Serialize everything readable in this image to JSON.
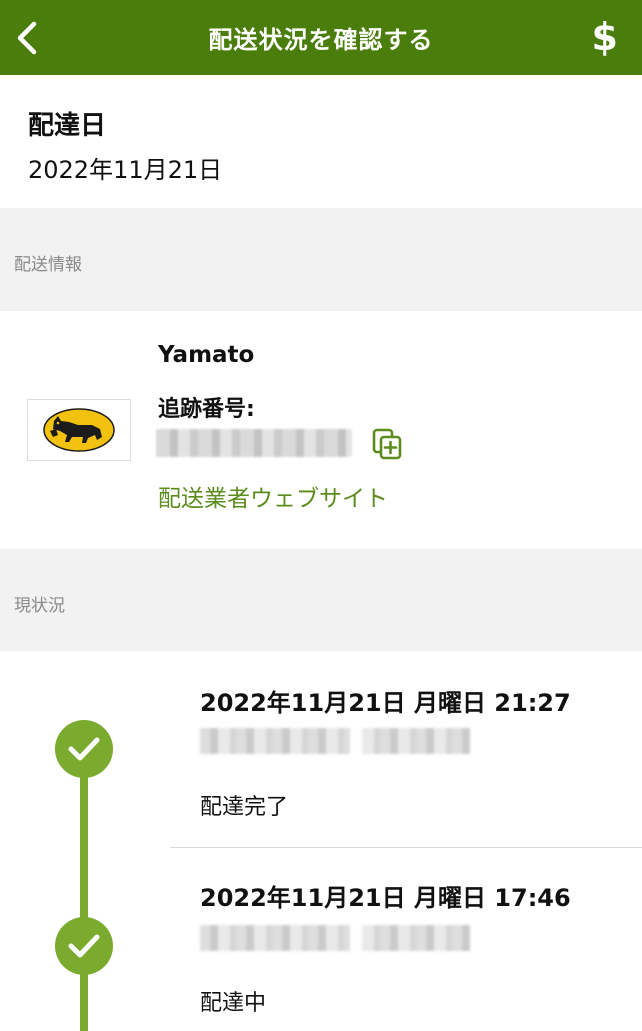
{
  "header": {
    "title": "配送状況を確認する",
    "back_icon": "chevron-left-icon",
    "currency_icon": "dollar-icon",
    "currency_symbol": "$",
    "background_color": "#4a7d0b"
  },
  "delivery_date": {
    "label": "配達日",
    "value": "2022年11月21日"
  },
  "shipping_info_section": {
    "label": "配送情報"
  },
  "carrier": {
    "logo_icon": "yamato-cat-logo",
    "name": "Yamato",
    "tracking_label": "追跡番号:",
    "tracking_number": "",
    "copy_icon": "copy-add-icon",
    "website_link": "配送業者ウェブサイト",
    "link_color": "#5b8c1c"
  },
  "status_section": {
    "label": "現状況"
  },
  "timeline": {
    "accent_color": "#7aaa2e",
    "events": [
      {
        "time": "2022年11月21日 月曜日 21:27",
        "location": "",
        "status": "配達完了",
        "icon": "check-circle-icon"
      },
      {
        "time": "2022年11月21日 月曜日 17:46",
        "location": "",
        "status": "配達中",
        "icon": "check-circle-icon"
      }
    ]
  }
}
